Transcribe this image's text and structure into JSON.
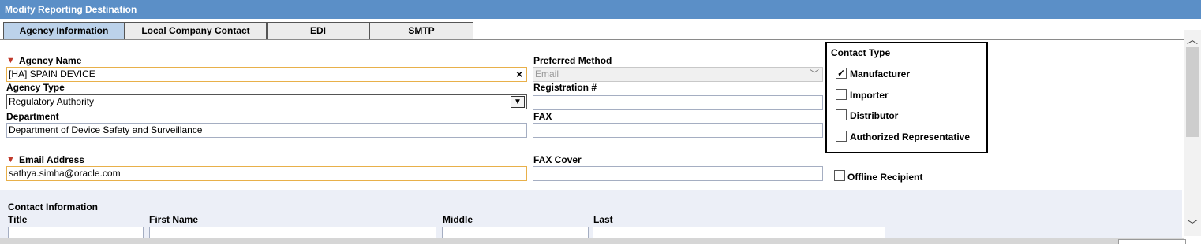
{
  "window": {
    "title": "Modify Reporting Destination"
  },
  "tabs": [
    "Agency Information",
    "Local Company Contact",
    "EDI",
    "SMTP"
  ],
  "form": {
    "agency_name": {
      "label": "Agency Name",
      "value": "[HA] SPAIN DEVICE"
    },
    "preferred_method": {
      "label": "Preferred Method",
      "value": "Email"
    },
    "agency_type": {
      "label": "Agency Type",
      "value": "Regulatory Authority"
    },
    "registration": {
      "label": "Registration #",
      "value": ""
    },
    "department": {
      "label": "Department",
      "value": "Department of Device Safety and Surveillance"
    },
    "fax": {
      "label": "FAX",
      "value": ""
    },
    "email": {
      "label": "Email Address",
      "value": "sathya.simha@oracle.com"
    },
    "fax_cover": {
      "label": "FAX Cover",
      "value": ""
    }
  },
  "contact_type": {
    "title": "Contact Type",
    "options": [
      {
        "label": "Manufacturer",
        "checked": true
      },
      {
        "label": "Importer",
        "checked": false
      },
      {
        "label": "Distributor",
        "checked": false
      },
      {
        "label": "Authorized Representative",
        "checked": false
      }
    ]
  },
  "offline_recipient": {
    "label": "Offline Recipient",
    "checked": false
  },
  "contact_info": {
    "title": "Contact Information",
    "fields": [
      "Title",
      "First Name",
      "Middle",
      "Last"
    ]
  },
  "icons": {
    "required": "required-flag-icon",
    "clear": "clear-x-icon",
    "dropdown": "chevron-down-icon",
    "check": "checkmark-icon"
  },
  "colors": {
    "titlebar": "#5b8fc7",
    "active_tab": "#bcd2ea",
    "required_border": "#e8b04a",
    "required_flag": "#c0392b"
  }
}
